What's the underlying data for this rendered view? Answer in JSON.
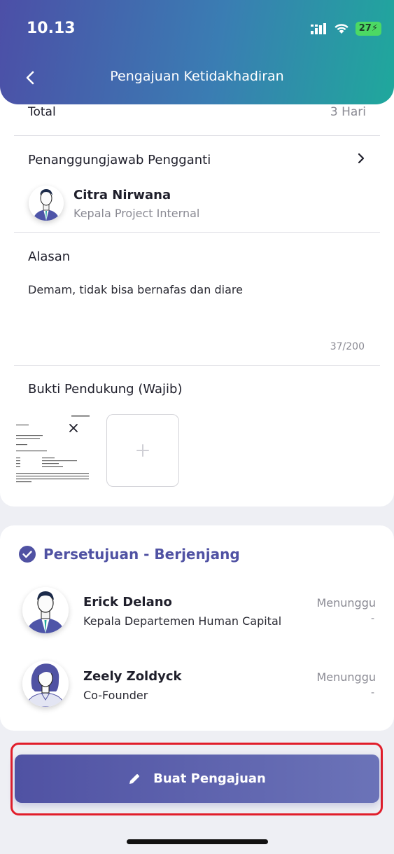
{
  "status_bar": {
    "time": "10.13",
    "battery": "27"
  },
  "header": {
    "title": "Pengajuan Ketidakhadiran"
  },
  "summary": {
    "total_label": "Total",
    "total_value": "3 Hari"
  },
  "substitute": {
    "section_title": "Penanggungjawab Pengganti",
    "name": "Citra Nirwana",
    "role": "Kepala Project Internal"
  },
  "reason": {
    "section_title": "Alasan",
    "text": "Demam, tidak bisa bernafas dan diare",
    "char_count": "37/200"
  },
  "evidence": {
    "section_title": "Bukti Pendukung (Wajib)",
    "add_icon": "plus-icon"
  },
  "approval": {
    "title": "Persetujuan - Berjenjang",
    "approvers": [
      {
        "name": "Erick Delano",
        "role": "Kepala Departemen Human Capital",
        "status": "Menunggu",
        "date": "-"
      },
      {
        "name": "Zeely Zoldyck",
        "role": "Co-Founder",
        "status": "Menunggu",
        "date": "-"
      }
    ]
  },
  "cta": {
    "label": "Buat Pengajuan",
    "icon": "pencil-icon"
  },
  "colors": {
    "header_start": "#4c4fa7",
    "header_end": "#1fa89c",
    "accent": "#5052a3",
    "highlight_border": "#e11d2a"
  }
}
